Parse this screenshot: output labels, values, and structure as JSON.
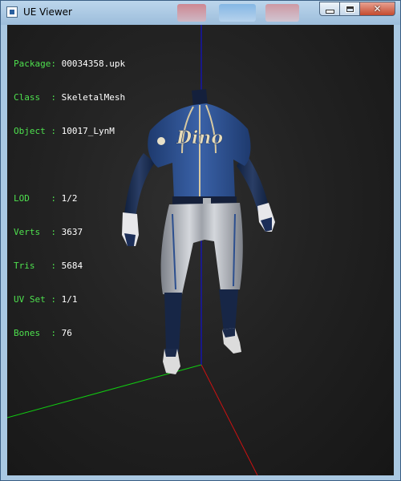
{
  "window": {
    "title": "UE Viewer"
  },
  "titlebar_controls": {
    "close_glyph": "✕"
  },
  "info": {
    "package": {
      "label": "Package:",
      "value": "00034358.upk"
    },
    "class": {
      "label": "Class  :",
      "value": "SkeletalMesh"
    },
    "object": {
      "label": "Object :",
      "value": "10017_LynM"
    },
    "lod": {
      "label": "LOD    :",
      "value": "1/2"
    },
    "verts": {
      "label": "Verts  :",
      "value": "3637"
    },
    "tris": {
      "label": "Tris   :",
      "value": "5684"
    },
    "uvset": {
      "label": "UV Set :",
      "value": "1/1"
    },
    "bones": {
      "label": "Bones  :",
      "value": "76"
    }
  },
  "jersey": {
    "lettering": "Dino"
  },
  "colors": {
    "info_label": "#4ee04e",
    "info_value": "#ffffff",
    "axis_x": "#cc1111",
    "axis_y": "#11cc11",
    "axis_z": "#1111cc",
    "jersey": "#2c4f8f",
    "pants": "#b8bcc2"
  }
}
